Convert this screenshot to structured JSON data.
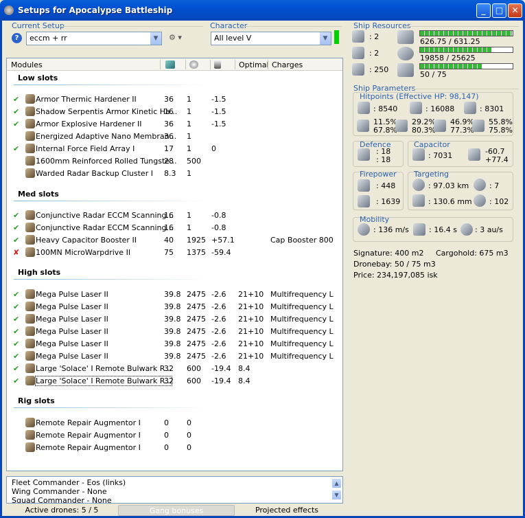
{
  "window": {
    "title": "Setups for Apocalypse Battleship",
    "min": "_",
    "max": "□",
    "close": "✕"
  },
  "current_setup": {
    "label": "Current Setup",
    "value": "eccm + rr"
  },
  "character": {
    "label": "Character",
    "value": "All level V"
  },
  "modules_header": {
    "modules": "Modules",
    "optimal": "Optimal",
    "charges": "Charges"
  },
  "sections": {
    "low": "Low slots",
    "med": "Med slots",
    "high": "High slots",
    "rig": "Rig slots"
  },
  "low_rows": [
    {
      "chk": "✔",
      "name": "Armor Thermic Hardener II",
      "cpu": "36",
      "pg": "1",
      "cap": "-1.5",
      "opt": "",
      "charge": ""
    },
    {
      "chk": "✔",
      "name": "Shadow Serpentis Armor Kinetic Ha...",
      "cpu": "16",
      "pg": "1",
      "cap": "-1.5",
      "opt": "",
      "charge": ""
    },
    {
      "chk": "✔",
      "name": "Armor Explosive Hardener II",
      "cpu": "36",
      "pg": "1",
      "cap": "-1.5",
      "opt": "",
      "charge": ""
    },
    {
      "chk": "",
      "name": "Energized Adaptive Nano Membran...",
      "cpu": "36",
      "pg": "1",
      "cap": "",
      "opt": "",
      "charge": ""
    },
    {
      "chk": "✔",
      "name": "Internal Force Field Array I",
      "cpu": "17",
      "pg": "1",
      "cap": "0",
      "opt": "",
      "charge": ""
    },
    {
      "chk": "",
      "name": "1600mm Reinforced Rolled Tungste...",
      "cpu": "28",
      "pg": "500",
      "cap": "",
      "opt": "",
      "charge": ""
    },
    {
      "chk": "",
      "name": "Warded Radar Backup Cluster I",
      "cpu": "8.3",
      "pg": "1",
      "cap": "",
      "opt": "",
      "charge": ""
    }
  ],
  "med_rows": [
    {
      "chk": "✔",
      "name": "Conjunctive Radar ECCM Scanning...",
      "cpu": "16",
      "pg": "1",
      "cap": "-0.8",
      "opt": "",
      "charge": ""
    },
    {
      "chk": "✔",
      "name": "Conjunctive Radar ECCM Scanning...",
      "cpu": "16",
      "pg": "1",
      "cap": "-0.8",
      "opt": "",
      "charge": ""
    },
    {
      "chk": "✔",
      "name": "Heavy Capacitor Booster II",
      "cpu": "40",
      "pg": "1925",
      "cap": "+57.1",
      "opt": "",
      "charge": "Cap Booster 800"
    },
    {
      "chk": "✘",
      "name": "100MN MicroWarpdrive II",
      "cpu": "75",
      "pg": "1375",
      "cap": "-59.4",
      "opt": "",
      "charge": ""
    }
  ],
  "high_rows": [
    {
      "chk": "✔",
      "name": "Mega Pulse Laser II",
      "cpu": "39.8",
      "pg": "2475",
      "cap": "-2.6",
      "opt": "21+10",
      "charge": "Multifrequency L"
    },
    {
      "chk": "✔",
      "name": "Mega Pulse Laser II",
      "cpu": "39.8",
      "pg": "2475",
      "cap": "-2.6",
      "opt": "21+10",
      "charge": "Multifrequency L"
    },
    {
      "chk": "✔",
      "name": "Mega Pulse Laser II",
      "cpu": "39.8",
      "pg": "2475",
      "cap": "-2.6",
      "opt": "21+10",
      "charge": "Multifrequency L"
    },
    {
      "chk": "✔",
      "name": "Mega Pulse Laser II",
      "cpu": "39.8",
      "pg": "2475",
      "cap": "-2.6",
      "opt": "21+10",
      "charge": "Multifrequency L"
    },
    {
      "chk": "✔",
      "name": "Mega Pulse Laser II",
      "cpu": "39.8",
      "pg": "2475",
      "cap": "-2.6",
      "opt": "21+10",
      "charge": "Multifrequency L"
    },
    {
      "chk": "✔",
      "name": "Mega Pulse Laser II",
      "cpu": "39.8",
      "pg": "2475",
      "cap": "-2.6",
      "opt": "21+10",
      "charge": "Multifrequency L"
    },
    {
      "chk": "✔",
      "name": "Large 'Solace' I Remote Bulwark R...",
      "cpu": "32",
      "pg": "600",
      "cap": "-19.4",
      "opt": "8.4",
      "charge": ""
    },
    {
      "chk": "✔",
      "name": "Large 'Solace' I Remote Bulwark R...",
      "cpu": "32",
      "pg": "600",
      "cap": "-19.4",
      "opt": "8.4",
      "charge": ""
    }
  ],
  "rig_rows": [
    {
      "chk": "",
      "name": "Remote Repair Augmentor I",
      "cpu": "0",
      "pg": "0",
      "cap": "",
      "opt": "",
      "charge": ""
    },
    {
      "chk": "",
      "name": "Remote Repair Augmentor I",
      "cpu": "0",
      "pg": "0",
      "cap": "",
      "opt": "",
      "charge": ""
    },
    {
      "chk": "",
      "name": "Remote Repair Augmentor I",
      "cpu": "0",
      "pg": "0",
      "cap": "",
      "opt": "",
      "charge": ""
    }
  ],
  "bottom_lines": [
    "Fleet Commander - Eos (links)",
    "Wing Commander - None",
    "Squad Commander - None"
  ],
  "status": {
    "drones": "Active drones: 5 / 5",
    "gang": "Gang bonuses",
    "projected": "Projected effects"
  },
  "resources": {
    "label": "Ship Resources",
    "turrets": ": 2",
    "launchers": ": 2",
    "calibration": ": 250",
    "cpu_text": "626.75 / 631.25",
    "cpu_frac": 0.993,
    "pg_text": "19858 / 25625",
    "pg_frac": 0.775,
    "bay_text": "50 / 75",
    "bay_frac": 0.667
  },
  "params": {
    "label": "Ship Parameters",
    "hp_label": "Hitpoints (Effective HP: 98,147)",
    "shield_hp": ": 8540",
    "armor_hp": ": 16088",
    "hull_hp": ": 8301",
    "res_shield_a": "11.5%",
    "res_shield_b": "67.8%",
    "res_em_a": "29.2%",
    "res_em_b": "80.3%",
    "res_kin_a": "46.9%",
    "res_kin_b": "77.3%",
    "res_exp_a": "55.8%",
    "res_exp_b": "75.8%",
    "defence_label": "Defence",
    "def_a": ": 18",
    "def_b": ": 18",
    "capacitor_label": "Capacitor",
    "cap_amount": ": 7031",
    "cap_a": "-60.7",
    "cap_b": "+77.4",
    "firepower_label": "Firepower",
    "fp_a": ": 448",
    "fp_b": ": 1639",
    "targeting_label": "Targeting",
    "range": ": 97.03 km",
    "targets": ": 7",
    "scan": ": 130.6 mm",
    "sig_res": ": 102",
    "mobility_label": "Mobility",
    "speed": ": 136 m/s",
    "align": ": 16.4 s",
    "warp": ": 3 au/s",
    "signature": "Signature: 400 m2",
    "cargohold": "Cargohold: 675 m3",
    "dronebay": "Dronebay: 50 / 75 m3",
    "price": "Price: 234,197,085 isk"
  }
}
